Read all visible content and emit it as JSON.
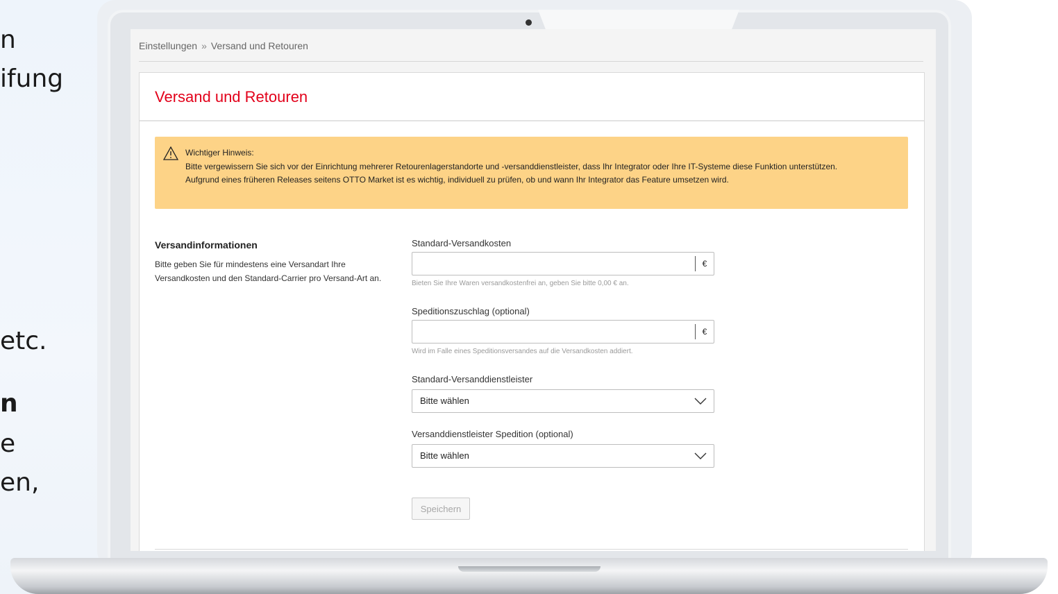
{
  "background_text": {
    "line1": "n",
    "line2": "ifung",
    "line3": "etc.",
    "line4": "n",
    "line5": "e",
    "line6": "en,"
  },
  "breadcrumb": {
    "items": [
      "Einstellungen",
      "Versand und Retouren"
    ],
    "separator": "»"
  },
  "card": {
    "title": "Versand und Retouren"
  },
  "alert": {
    "icon": "warning-icon",
    "title": "Wichtiger Hinweis:",
    "line1": "Bitte vergewissern Sie sich vor der Einrichtung mehrerer Retourenlagerstandorte und -versanddienstleister, dass Ihr Integrator oder Ihre IT-Systeme diese Funktion unterstützen.",
    "line2": "Aufgrund eines früheren Releases seitens OTTO Market ist es wichtig, individuell zu prüfen, ob und wann Ihr Integrator das Feature umsetzen wird.",
    "color": "#fdd387"
  },
  "section": {
    "title": "Versandinformationen",
    "description": "Bitte geben Sie für mindestens eine Versandart Ihre Versandkosten und den Standard-Carrier pro Versand-Art an."
  },
  "fields": {
    "shipping_cost": {
      "label": "Standard-Versandkosten",
      "value": "",
      "suffix": "€",
      "hint": "Bieten Sie Ihre Waren versandkostenfrei an, geben Sie bitte 0,00 € an."
    },
    "freight_surcharge": {
      "label": "Speditionszuschlag (optional)",
      "value": "",
      "suffix": "€",
      "hint": "Wird im Falle eines Speditionsversandes auf die Versandkosten addiert."
    },
    "carrier": {
      "label": "Standard-Versanddienstleister",
      "selected": "Bitte wählen"
    },
    "freight_carrier": {
      "label": "Versanddienstleister Spedition (optional)",
      "selected": "Bitte wählen"
    }
  },
  "actions": {
    "save_label": "Speichern"
  },
  "colors": {
    "accent": "#e2001a",
    "alert_bg": "#fdd387"
  }
}
